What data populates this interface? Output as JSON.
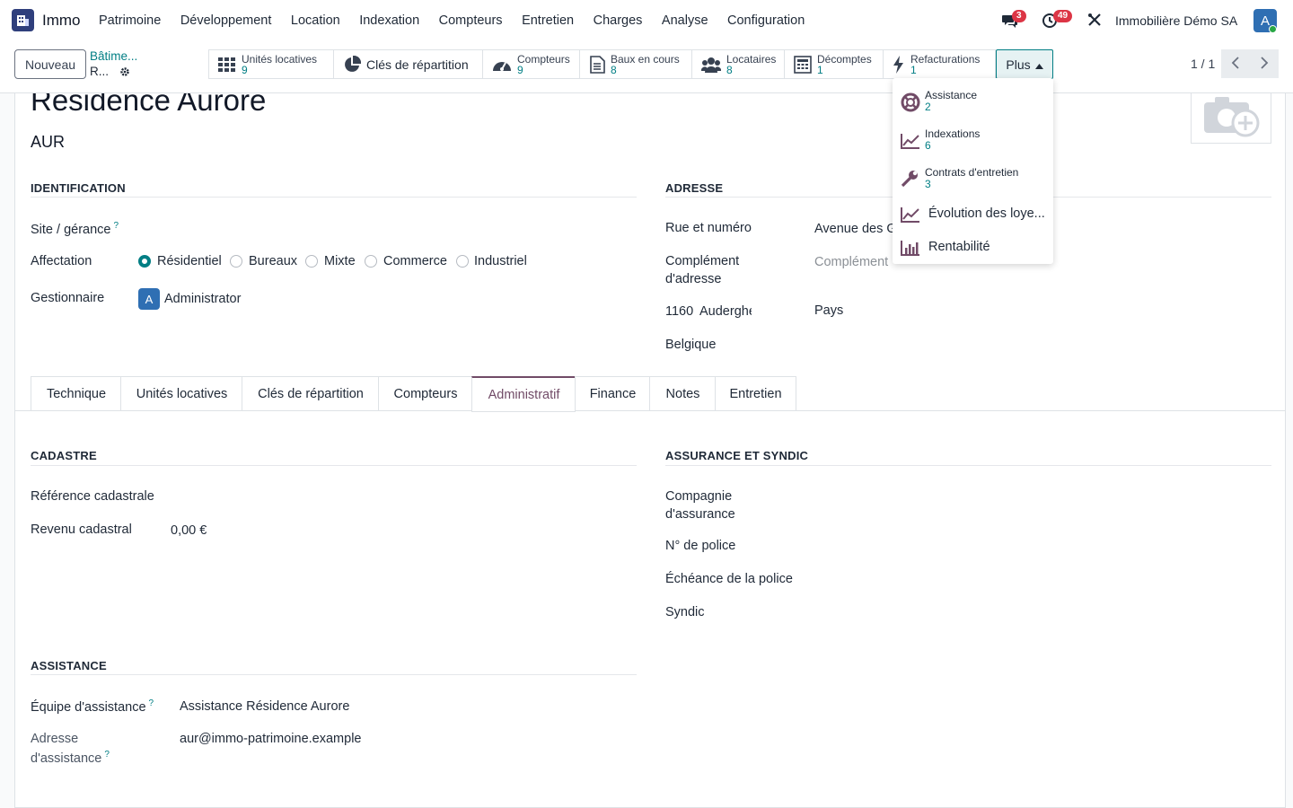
{
  "app": {
    "name": "Immo",
    "company": "Immobilière Démo SA",
    "user_initial": "A"
  },
  "menu": [
    "Patrimoine",
    "Développement",
    "Location",
    "Indexation",
    "Compteurs",
    "Entretien",
    "Charges",
    "Analyse",
    "Configuration"
  ],
  "notifications": {
    "messages": "3",
    "activities": "49"
  },
  "control": {
    "new_label": "Nouveau",
    "breadcrumb": "Bâtime...",
    "record_short": "R...",
    "plus_label": "Plus",
    "pager": "1 / 1"
  },
  "smart_buttons": [
    {
      "label": "Unités locatives",
      "count": "9",
      "icon": "grid-icon"
    },
    {
      "label": "Clés de répartition",
      "count": "",
      "icon": "pie-icon"
    },
    {
      "label": "Compteurs",
      "count": "9",
      "icon": "gauge-icon"
    },
    {
      "label": "Baux en cours",
      "count": "8",
      "icon": "document-icon"
    },
    {
      "label": "Locataires",
      "count": "8",
      "icon": "users-icon"
    },
    {
      "label": "Décomptes",
      "count": "1",
      "icon": "calculator-icon"
    },
    {
      "label": "Refacturations",
      "count": "1",
      "icon": "bolt-icon"
    }
  ],
  "dropdown": [
    {
      "label": "Assistance",
      "count": "2",
      "icon": "lifebuoy-icon"
    },
    {
      "label": "Indexations",
      "count": "6",
      "icon": "line-chart-icon"
    },
    {
      "label": "Contrats d'entretien",
      "count": "3",
      "icon": "wrench-icon"
    },
    {
      "label": "Évolution des loye...",
      "count": "",
      "icon": "line-chart-icon"
    },
    {
      "label": "Rentabilité",
      "count": "",
      "icon": "bar-chart-icon"
    }
  ],
  "record": {
    "title": "Résidence Aurore",
    "code": "AUR"
  },
  "identification": {
    "title": "IDENTIFICATION",
    "site_label": "Site / gérance",
    "affectation_label": "Affectation",
    "affectation_options": [
      "Résidentiel",
      "Bureaux",
      "Mixte",
      "Commerce",
      "Industriel"
    ],
    "affectation_selected": "Résidentiel",
    "gestionnaire_label": "Gestionnaire",
    "gestionnaire_value": "Administrator",
    "gestionnaire_initial": "A"
  },
  "adresse": {
    "title": "ADRESSE",
    "street_label": "Rue et numéro",
    "street_value": "Avenue des G",
    "complement_label_1": "Complément",
    "complement_label_2": "d'adresse",
    "complement_placeholder": "Complément",
    "zip": "1160",
    "city": "Auderghe",
    "country_label": "Pays",
    "country_value": "Belgique"
  },
  "tabs": [
    "Technique",
    "Unités locatives",
    "Clés de répartition",
    "Compteurs",
    "Administratif",
    "Finance",
    "Notes",
    "Entretien"
  ],
  "active_tab": "Administratif",
  "cadastre": {
    "title": "CADASTRE",
    "ref_label": "Référence cadastrale",
    "revenu_label": "Revenu cadastral",
    "revenu_value": "0,00 €"
  },
  "assurance": {
    "title": "ASSURANCE ET SYNDIC",
    "compagnie_label_1": "Compagnie",
    "compagnie_label_2": "d'assurance",
    "police_label": "N° de police",
    "echeance_label": "Échéance de la police",
    "syndic_label": "Syndic"
  },
  "assistance": {
    "title": "ASSISTANCE",
    "equipe_label": "Équipe d'assistance",
    "equipe_value": "Assistance Résidence Aurore",
    "adresse_label_1": "Adresse",
    "adresse_label_2": "d'assistance",
    "adresse_value": "aur@immo-patrimoine.example"
  },
  "colors": {
    "accent": "#017e84",
    "brand": "#714b67",
    "badge": "#dc3545"
  }
}
